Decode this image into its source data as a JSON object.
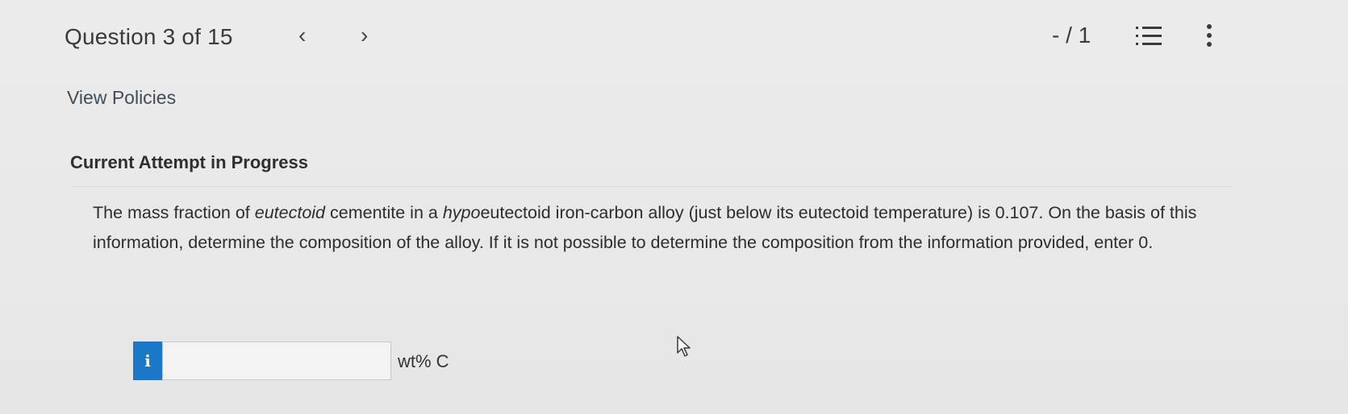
{
  "header": {
    "question_title": "Question 3 of 15",
    "prev_icon": "chevron-left-icon",
    "next_icon": "chevron-right-icon",
    "score": "- / 1",
    "list_icon": "numbered-list-icon",
    "more_icon": "more-vertical-icon"
  },
  "policies": {
    "link_text": "View Policies"
  },
  "attempt": {
    "heading": "Current Attempt in Progress"
  },
  "question": {
    "text_part1": "The mass fraction of ",
    "emph1": "eutectoid",
    "text_part2": " cementite in a ",
    "emph2": "hypo",
    "text_part3": "eutectoid iron-carbon alloy (just below its eutectoid temperature) is 0.107. On the basis of this information, determine the composition of the alloy. If it is not possible to determine the composition from the information provided, enter 0."
  },
  "answer": {
    "info_badge": "i",
    "input_value": "",
    "unit": "wt% C"
  },
  "colors": {
    "info_badge": "#1a78c8",
    "background": "#e9e9e9"
  }
}
